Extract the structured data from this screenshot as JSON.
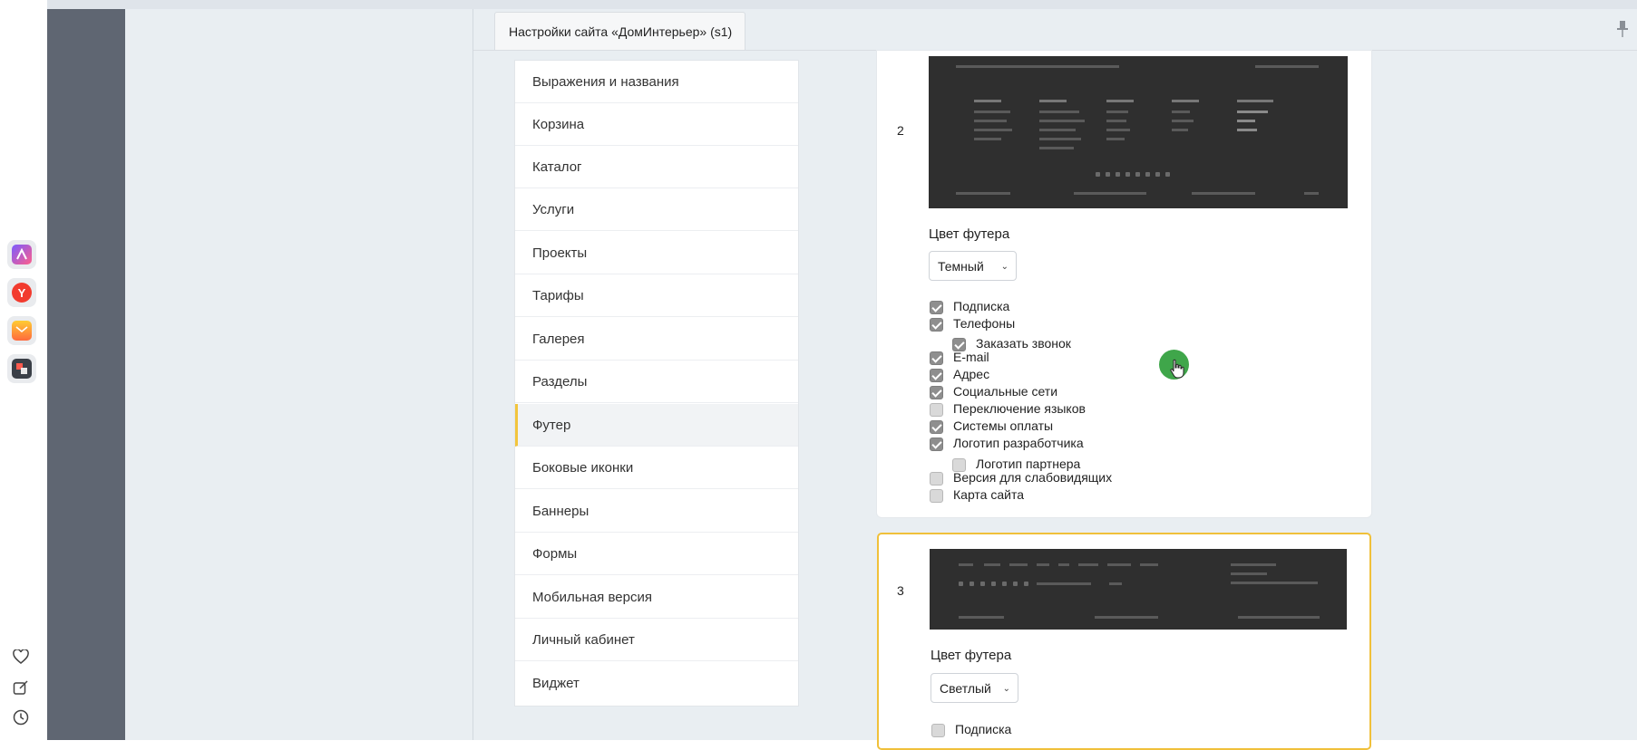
{
  "tab": {
    "title": "Настройки сайта «ДомИнтерьер» (s1)"
  },
  "menu": {
    "items": [
      {
        "label": "Выражения и названия"
      },
      {
        "label": "Корзина"
      },
      {
        "label": "Каталог"
      },
      {
        "label": "Услуги"
      },
      {
        "label": "Проекты"
      },
      {
        "label": "Тарифы"
      },
      {
        "label": "Галерея"
      },
      {
        "label": "Разделы"
      },
      {
        "label": "Футер",
        "active": true
      },
      {
        "label": "Боковые иконки"
      },
      {
        "label": "Баннеры"
      },
      {
        "label": "Формы"
      },
      {
        "label": "Мобильная версия"
      },
      {
        "label": "Личный кабинет"
      },
      {
        "label": "Виджет"
      }
    ]
  },
  "footer_variants": [
    {
      "number": "2",
      "color_label": "Цвет футера",
      "color_value": "Темный",
      "options": [
        {
          "label": "Подписка",
          "checked": true
        },
        {
          "label": "Телефоны",
          "checked": true
        },
        {
          "label": "Заказать звонок",
          "checked": true,
          "nested": true
        },
        {
          "label": "E-mail",
          "checked": true
        },
        {
          "label": "Адрес",
          "checked": true
        },
        {
          "label": "Социальные сети",
          "checked": true
        },
        {
          "label": "Переключение языков",
          "checked": false
        },
        {
          "label": "Системы оплаты",
          "checked": true
        },
        {
          "label": "Логотип разработчика",
          "checked": true
        },
        {
          "label": "Логотип партнера",
          "checked": false,
          "nested": true
        },
        {
          "label": "Версия для слабовидящих",
          "checked": false
        },
        {
          "label": "Карта сайта",
          "checked": false
        }
      ]
    },
    {
      "number": "3",
      "color_label": "Цвет футера",
      "color_value": "Светлый",
      "options": [
        {
          "label": "Подписка",
          "checked": false
        }
      ]
    }
  ],
  "dock": {
    "apps": [
      "figma-icon",
      "yandex-browser-icon",
      "mail-icon",
      "translate-icon"
    ],
    "tools": [
      "heart-icon",
      "edit-icon",
      "clock-icon"
    ]
  },
  "colors": {
    "accent": "#f0c03a",
    "sidebar_dark": "#5f6672",
    "cursor": "#3fa64a"
  }
}
